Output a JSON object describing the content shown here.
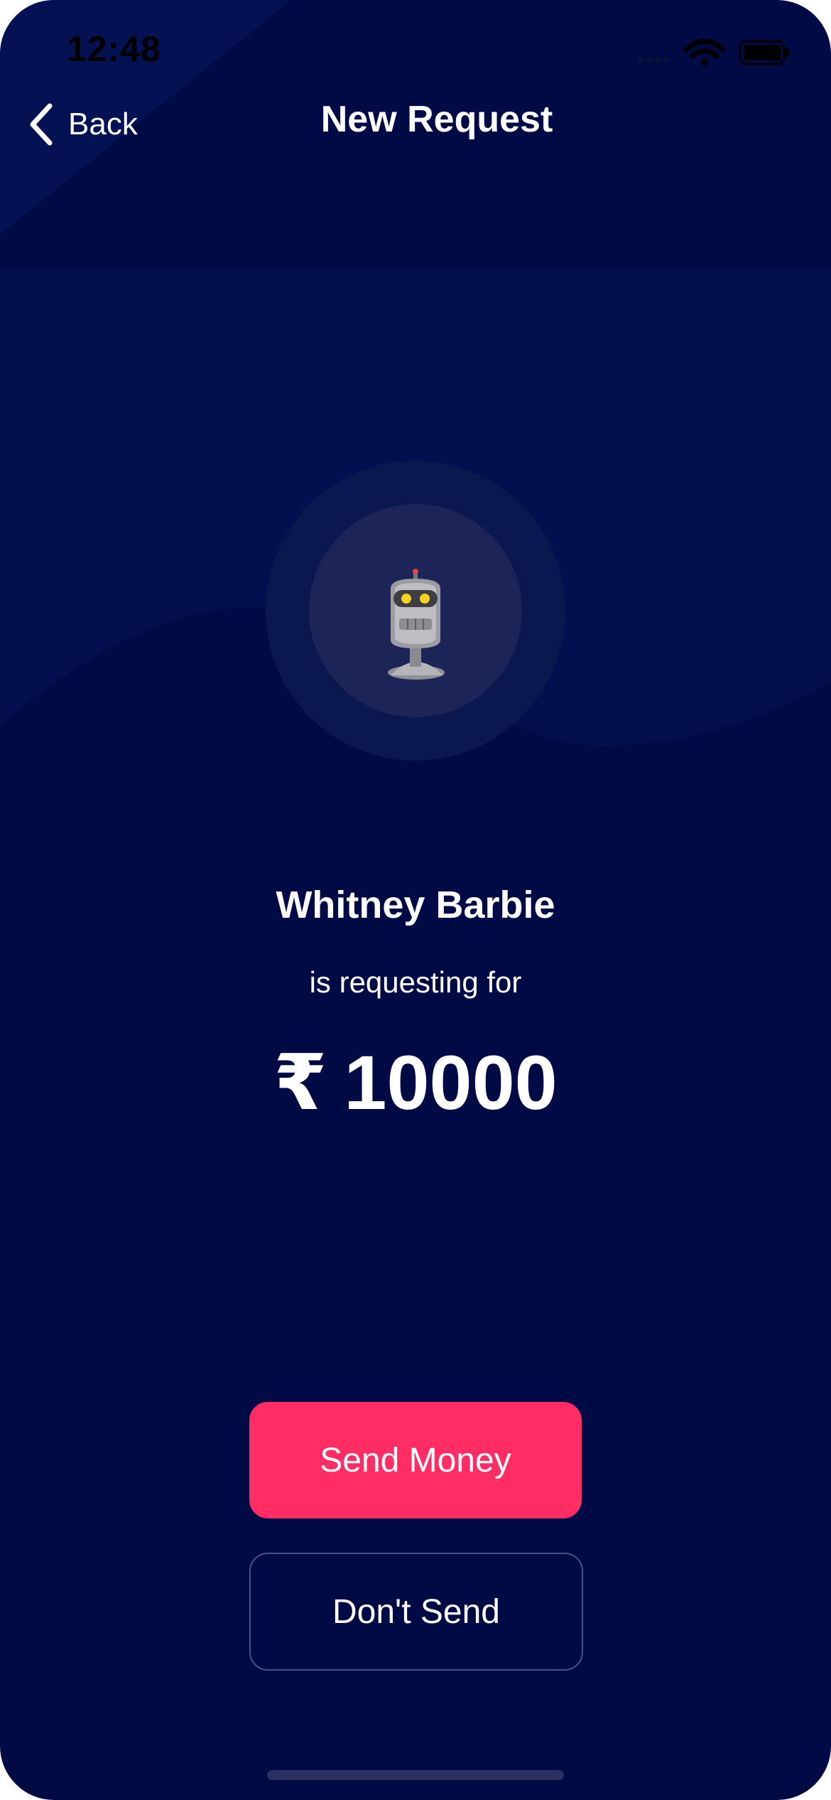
{
  "status_bar": {
    "time": "12:48",
    "icons": [
      "cellular-signal-icon",
      "wifi-icon",
      "battery-icon"
    ]
  },
  "nav": {
    "back_label": "Back",
    "title": "New Request"
  },
  "avatar": {
    "icon": "robot-avatar-icon"
  },
  "request": {
    "name": "Whitney Barbie",
    "subtitle": "is requesting for",
    "currency_symbol": "₹",
    "amount": "10000"
  },
  "actions": {
    "send_label": "Send Money",
    "dont_send_label": "Don't Send"
  },
  "colors": {
    "background": "#000b45",
    "primary_button": "#ff2d63",
    "avatar_ring_outer": "#0b1850",
    "avatar_ring_inner": "#1c2458",
    "text": "#ffffff"
  }
}
